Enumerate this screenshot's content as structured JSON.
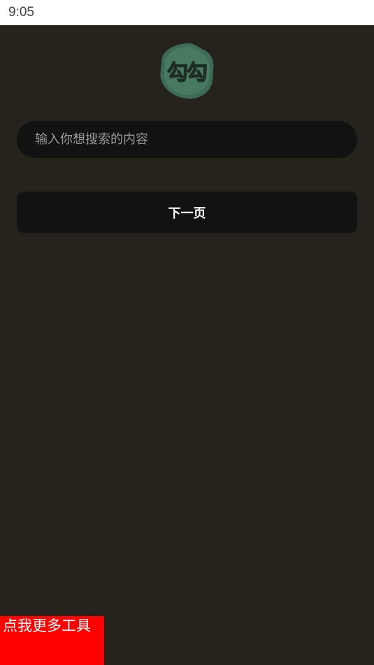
{
  "status_bar": {
    "time": "9:05"
  },
  "logo": {
    "text": "勾勾",
    "icon": "blob-logo-icon",
    "fill_color": "#3d6b55"
  },
  "search": {
    "placeholder": "输入你想搜索的内容",
    "value": ""
  },
  "next_button": {
    "label": "下一页"
  },
  "tools_button": {
    "label": "点我更多工具",
    "color": "#ff0000"
  },
  "colors": {
    "background": "#26231d",
    "field": "#121212"
  }
}
